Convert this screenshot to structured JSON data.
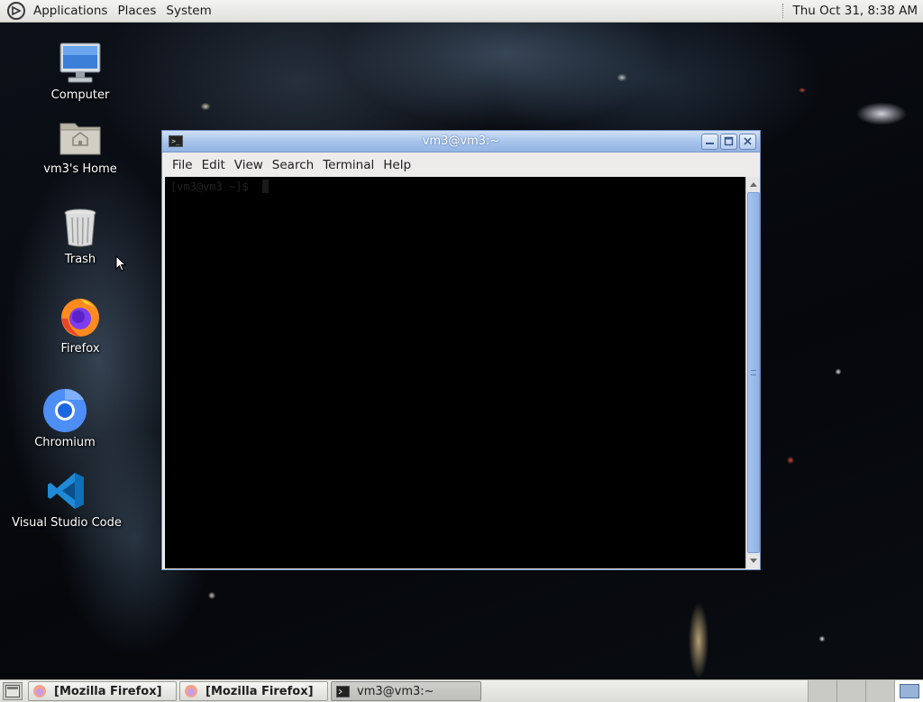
{
  "top_panel": {
    "menus": [
      "Applications",
      "Places",
      "System"
    ],
    "clock": "Thu Oct 31,  8:38 AM"
  },
  "desktop_icons": [
    {
      "label": "Computer",
      "icon": "computer-icon"
    },
    {
      "label": "vm3's Home",
      "icon": "home-folder-icon"
    },
    {
      "label": "Trash",
      "icon": "trash-icon"
    },
    {
      "label": "Firefox",
      "icon": "firefox-icon"
    },
    {
      "label": "Chromium",
      "icon": "chromium-icon"
    },
    {
      "label": "Visual Studio Code",
      "icon": "vscode-icon"
    }
  ],
  "terminal": {
    "title": "vm3@vm3:~",
    "menus": [
      "File",
      "Edit",
      "View",
      "Search",
      "Terminal",
      "Help"
    ],
    "prompt": "[vm3@vm3 ~]$"
  },
  "taskbar": {
    "tasks": [
      {
        "label": "[Mozilla Firefox]",
        "icon": "firefox-icon"
      },
      {
        "label": "[Mozilla Firefox]",
        "icon": "firefox-icon"
      },
      {
        "label": "vm3@vm3:~",
        "icon": "terminal-icon"
      }
    ],
    "workspace_count": 4,
    "active_workspace": 4
  },
  "colors": {
    "titlebar_accent": "#a5c2ea",
    "terminal_bg": "#000000"
  }
}
